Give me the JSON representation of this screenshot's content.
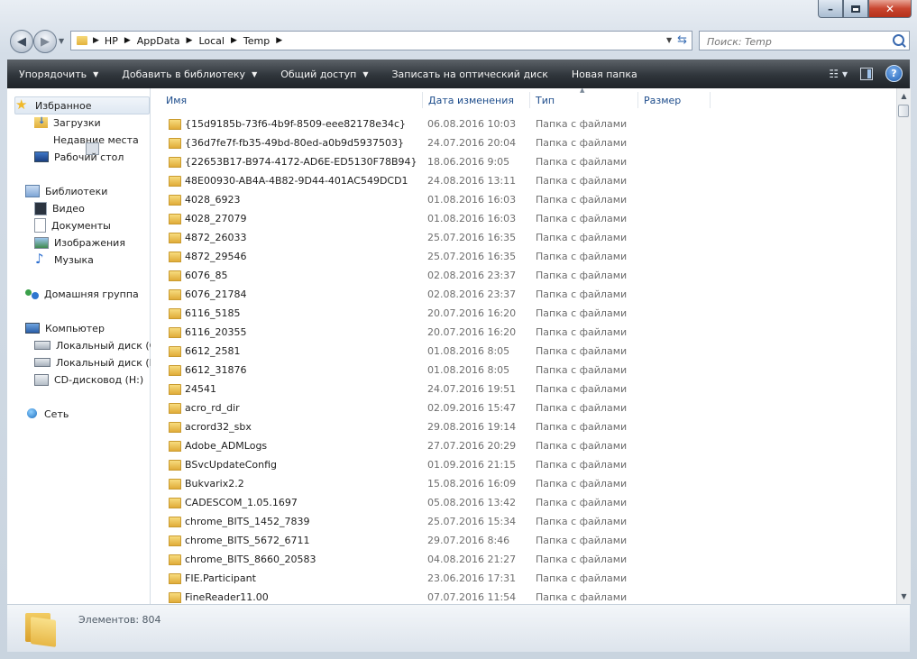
{
  "window": {
    "caption_buttons": [
      "min",
      "max",
      "close"
    ]
  },
  "address": {
    "crumbs": [
      "HP",
      "AppData",
      "Local",
      "Temp"
    ]
  },
  "search": {
    "placeholder": "Поиск: Temp"
  },
  "toolbar": {
    "organize": "Упорядочить",
    "add_to_library": "Добавить в библиотеку",
    "share": "Общий доступ",
    "burn": "Записать на оптический диск",
    "new_folder": "Новая папка",
    "help": "?"
  },
  "navpane": {
    "favorites": "Избранное",
    "downloads": "Загрузки",
    "recent_places": "Недавние места",
    "desktop": "Рабочий стол",
    "libraries": "Библиотеки",
    "video": "Видео",
    "documents": "Документы",
    "pictures": "Изображения",
    "music": "Музыка",
    "homegroup": "Домашняя группа",
    "computer": "Компьютер",
    "drive_c": "Локальный диск (C:)",
    "drive_d": "Локальный диск (D:)",
    "cd_drive": "CD-дисковод (H:)",
    "network": "Сеть"
  },
  "columns": {
    "name": "Имя",
    "date": "Дата изменения",
    "type": "Тип",
    "size": "Размер"
  },
  "files": [
    {
      "name": "{15d9185b-73f6-4b9f-8509-eee82178e34c}",
      "date": "06.08.2016 10:03",
      "type": "Папка с файлами"
    },
    {
      "name": "{36d7fe7f-fb35-49bd-80ed-a0b9d5937503}",
      "date": "24.07.2016 20:04",
      "type": "Папка с файлами"
    },
    {
      "name": "{22653B17-B974-4172-AD6E-ED5130F78B94}",
      "date": "18.06.2016 9:05",
      "type": "Папка с файлами"
    },
    {
      "name": "48E00930-AB4A-4B82-9D44-401AC549DCD1",
      "date": "24.08.2016 13:11",
      "type": "Папка с файлами"
    },
    {
      "name": "4028_6923",
      "date": "01.08.2016 16:03",
      "type": "Папка с файлами"
    },
    {
      "name": "4028_27079",
      "date": "01.08.2016 16:03",
      "type": "Папка с файлами"
    },
    {
      "name": "4872_26033",
      "date": "25.07.2016 16:35",
      "type": "Папка с файлами"
    },
    {
      "name": "4872_29546",
      "date": "25.07.2016 16:35",
      "type": "Папка с файлами"
    },
    {
      "name": "6076_85",
      "date": "02.08.2016 23:37",
      "type": "Папка с файлами"
    },
    {
      "name": "6076_21784",
      "date": "02.08.2016 23:37",
      "type": "Папка с файлами"
    },
    {
      "name": "6116_5185",
      "date": "20.07.2016 16:20",
      "type": "Папка с файлами"
    },
    {
      "name": "6116_20355",
      "date": "20.07.2016 16:20",
      "type": "Папка с файлами"
    },
    {
      "name": "6612_2581",
      "date": "01.08.2016 8:05",
      "type": "Папка с файлами"
    },
    {
      "name": "6612_31876",
      "date": "01.08.2016 8:05",
      "type": "Папка с файлами"
    },
    {
      "name": "24541",
      "date": "24.07.2016 19:51",
      "type": "Папка с файлами"
    },
    {
      "name": "acro_rd_dir",
      "date": "02.09.2016 15:47",
      "type": "Папка с файлами"
    },
    {
      "name": "acrord32_sbx",
      "date": "29.08.2016 19:14",
      "type": "Папка с файлами"
    },
    {
      "name": "Adobe_ADMLogs",
      "date": "27.07.2016 20:29",
      "type": "Папка с файлами"
    },
    {
      "name": "BSvcUpdateConfig",
      "date": "01.09.2016 21:15",
      "type": "Папка с файлами"
    },
    {
      "name": "Bukvarix2.2",
      "date": "15.08.2016 16:09",
      "type": "Папка с файлами"
    },
    {
      "name": "CADESCOM_1.05.1697",
      "date": "05.08.2016 13:42",
      "type": "Папка с файлами"
    },
    {
      "name": "chrome_BITS_1452_7839",
      "date": "25.07.2016 15:34",
      "type": "Папка с файлами"
    },
    {
      "name": "chrome_BITS_5672_6711",
      "date": "29.07.2016 8:46",
      "type": "Папка с файлами"
    },
    {
      "name": "chrome_BITS_8660_20583",
      "date": "04.08.2016 21:27",
      "type": "Папка с файлами"
    },
    {
      "name": "FIE.Participant",
      "date": "23.06.2016 17:31",
      "type": "Папка с файлами"
    },
    {
      "name": "FineReader11.00",
      "date": "07.07.2016 11:54",
      "type": "Папка с файлами"
    }
  ],
  "status": {
    "item_count": "Элементов: 804"
  }
}
